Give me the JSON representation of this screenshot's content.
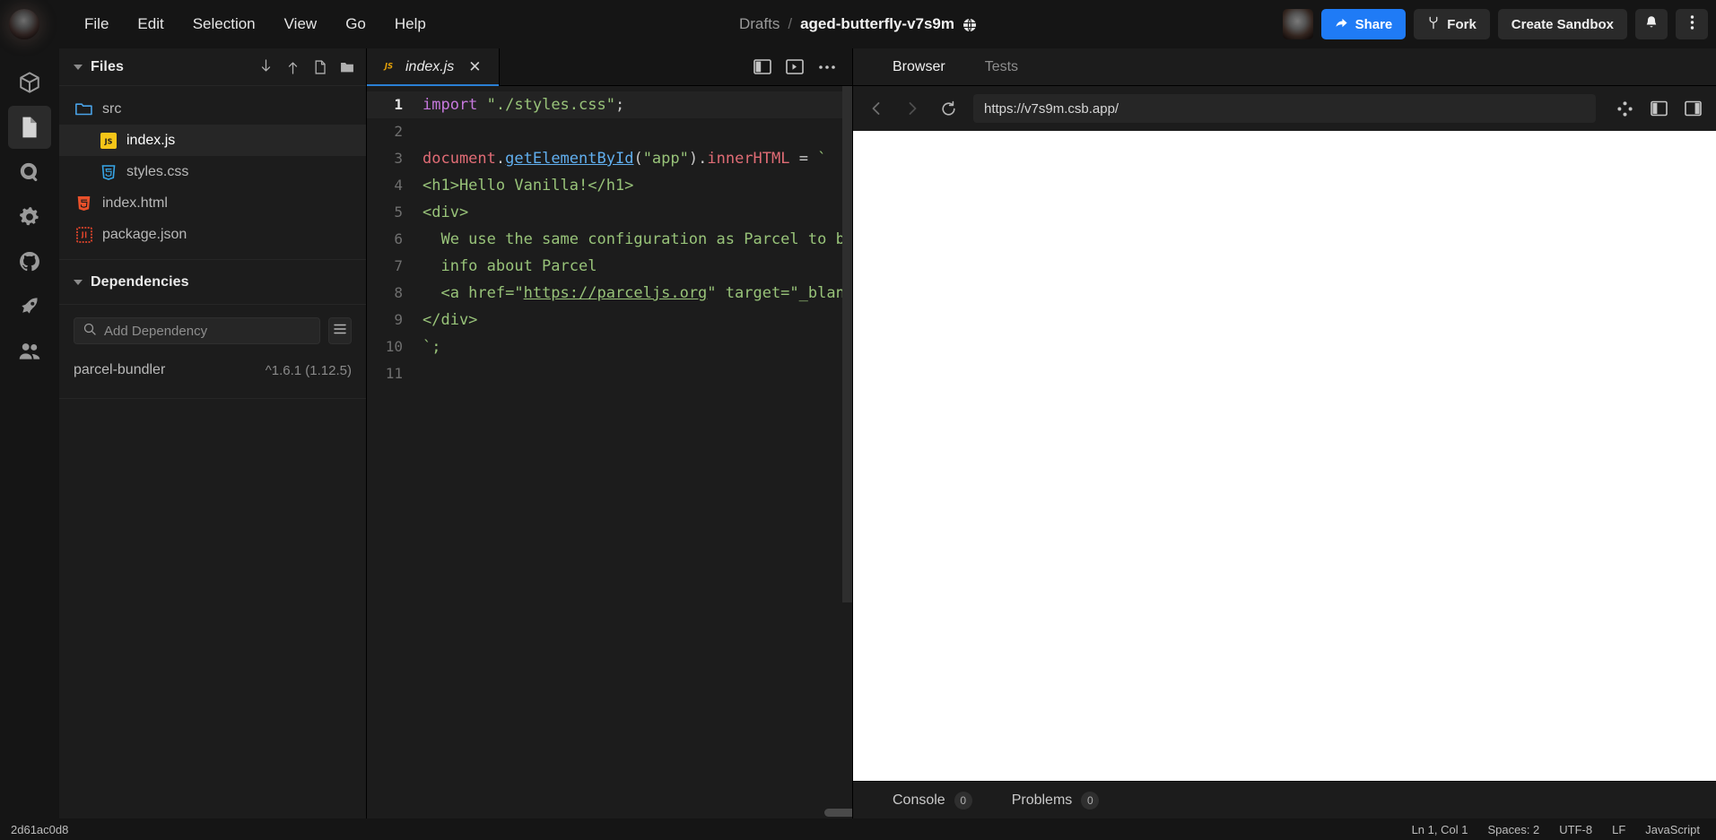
{
  "titlebar": {
    "logo_name": "codesandbox-logo",
    "menu": [
      {
        "label": "File"
      },
      {
        "label": "Edit"
      },
      {
        "label": "Selection"
      },
      {
        "label": "View"
      },
      {
        "label": "Go"
      },
      {
        "label": "Help"
      }
    ],
    "breadcrumb": {
      "workspace": "Drafts",
      "separator": "/",
      "sandbox": "aged-butterfly-v7s9m",
      "visibility_icon": "globe-icon"
    },
    "actions": {
      "avatar": "user-avatar",
      "share": "Share",
      "fork": "Fork",
      "create_sandbox": "Create Sandbox",
      "notifications_icon": "bell-icon",
      "more_icon": "kebab-menu-icon"
    },
    "accent_color": "#1f7bf6"
  },
  "rail": {
    "items": [
      {
        "name": "sandbox-icon",
        "label": "Sandbox",
        "active": false
      },
      {
        "name": "files-icon",
        "label": "Explorer",
        "active": true
      },
      {
        "name": "search-icon",
        "label": "Search",
        "active": false
      },
      {
        "name": "gear-icon",
        "label": "Settings",
        "active": false
      },
      {
        "name": "github-icon",
        "label": "GitHub",
        "active": false
      },
      {
        "name": "rocket-icon",
        "label": "Deployment",
        "active": false
      },
      {
        "name": "people-icon",
        "label": "Live",
        "active": false
      }
    ]
  },
  "sidebar": {
    "files_panel": {
      "title": "Files",
      "actions": [
        {
          "name": "download-icon"
        },
        {
          "name": "upload-icon"
        },
        {
          "name": "new-file-icon"
        },
        {
          "name": "new-folder-icon"
        }
      ],
      "tree": [
        {
          "label": "src",
          "icon": "folder-icon",
          "kind": "folder",
          "indent": false,
          "selected": false
        },
        {
          "label": "index.js",
          "icon": "js-file-icon",
          "kind": "file",
          "indent": true,
          "selected": true
        },
        {
          "label": "styles.css",
          "icon": "css-file-icon",
          "kind": "file",
          "indent": true,
          "selected": false
        },
        {
          "label": "index.html",
          "icon": "html-file-icon",
          "kind": "file",
          "indent": false,
          "selected": false
        },
        {
          "label": "package.json",
          "icon": "json-file-icon",
          "kind": "file",
          "indent": false,
          "selected": false
        }
      ]
    },
    "dependencies_panel": {
      "title": "Dependencies",
      "search_placeholder": "Add Dependency",
      "search_value": "",
      "search_icon": "search-icon",
      "menu_icon": "list-menu-icon",
      "items": [
        {
          "name": "parcel-bundler",
          "version": "^1.6.1 (1.12.5)"
        }
      ]
    }
  },
  "editor": {
    "tabs": [
      {
        "label": "index.js",
        "icon": "js-file-icon",
        "active": true,
        "close_icon": "close-icon"
      }
    ],
    "tab_actions": [
      {
        "name": "split-editor-icon"
      },
      {
        "name": "open-preview-icon"
      },
      {
        "name": "more-options-icon"
      }
    ],
    "lines": [
      {
        "n": "1",
        "current": true,
        "tokens": [
          {
            "t": "import",
            "c": "t-kw"
          },
          {
            "t": " ",
            "c": "t-plain"
          },
          {
            "t": "\"./styles.css\"",
            "c": "t-str"
          },
          {
            "t": ";",
            "c": "t-punc"
          }
        ]
      },
      {
        "n": "2",
        "current": false,
        "tokens": []
      },
      {
        "n": "3",
        "current": false,
        "tokens": [
          {
            "t": "document",
            "c": "t-var"
          },
          {
            "t": ".",
            "c": "t-punc"
          },
          {
            "t": "getElementById",
            "c": "t-fn"
          },
          {
            "t": "(",
            "c": "t-punc"
          },
          {
            "t": "\"app\"",
            "c": "t-str"
          },
          {
            "t": ")",
            "c": "t-punc"
          },
          {
            "t": ".",
            "c": "t-punc"
          },
          {
            "t": "innerHTML",
            "c": "t-prop"
          },
          {
            "t": " = ",
            "c": "t-punc"
          },
          {
            "t": "`",
            "c": "t-str"
          }
        ]
      },
      {
        "n": "4",
        "current": false,
        "tokens": [
          {
            "t": "<h1>Hello Vanilla!</h1>",
            "c": "t-html"
          }
        ]
      },
      {
        "n": "5",
        "current": false,
        "tokens": [
          {
            "t": "<div>",
            "c": "t-html"
          }
        ]
      },
      {
        "n": "6",
        "current": false,
        "tokens": [
          {
            "t": "  We use the same configuration as Parcel to bundle this sandbox, you can find more",
            "c": "t-html"
          }
        ]
      },
      {
        "n": "7",
        "current": false,
        "tokens": [
          {
            "t": "  info about Parcel",
            "c": "t-html"
          }
        ]
      },
      {
        "n": "8",
        "current": false,
        "tokens": [
          {
            "t": "  <a href=\"",
            "c": "t-html"
          },
          {
            "t": "https://parceljs.org",
            "c": "t-link"
          },
          {
            "t": "\" target=\"_blank\" rel=\"noopener noreferrer\">here</a>.",
            "c": "t-html"
          }
        ]
      },
      {
        "n": "9",
        "current": false,
        "tokens": [
          {
            "t": "</div>",
            "c": "t-html"
          }
        ]
      },
      {
        "n": "10",
        "current": false,
        "tokens": [
          {
            "t": "`;",
            "c": "t-str"
          }
        ]
      },
      {
        "n": "11",
        "current": false,
        "tokens": []
      }
    ]
  },
  "preview": {
    "tabs": [
      {
        "label": "Browser",
        "active": true
      },
      {
        "label": "Tests",
        "active": false
      }
    ],
    "nav": {
      "back_icon": "chevron-left-icon",
      "forward_icon": "chevron-right-icon",
      "reload_icon": "reload-icon",
      "url": "https://v7s9m.csb.app/",
      "url_placeholder": "https://"
    },
    "url_actions": [
      {
        "name": "responsive-mode-icon"
      },
      {
        "name": "open-in-new-window-icon"
      },
      {
        "name": "open-in-editor-icon"
      }
    ],
    "footer_tabs": [
      {
        "label": "Console",
        "count": "0"
      },
      {
        "label": "Problems",
        "count": "0"
      }
    ]
  },
  "statusbar": {
    "left": [
      {
        "label": "2d61ac0d8"
      }
    ],
    "right": [
      {
        "label": "Ln 1, Col 1"
      },
      {
        "label": "Spaces: 2"
      },
      {
        "label": "UTF-8"
      },
      {
        "label": "LF"
      },
      {
        "label": "JavaScript"
      }
    ]
  }
}
